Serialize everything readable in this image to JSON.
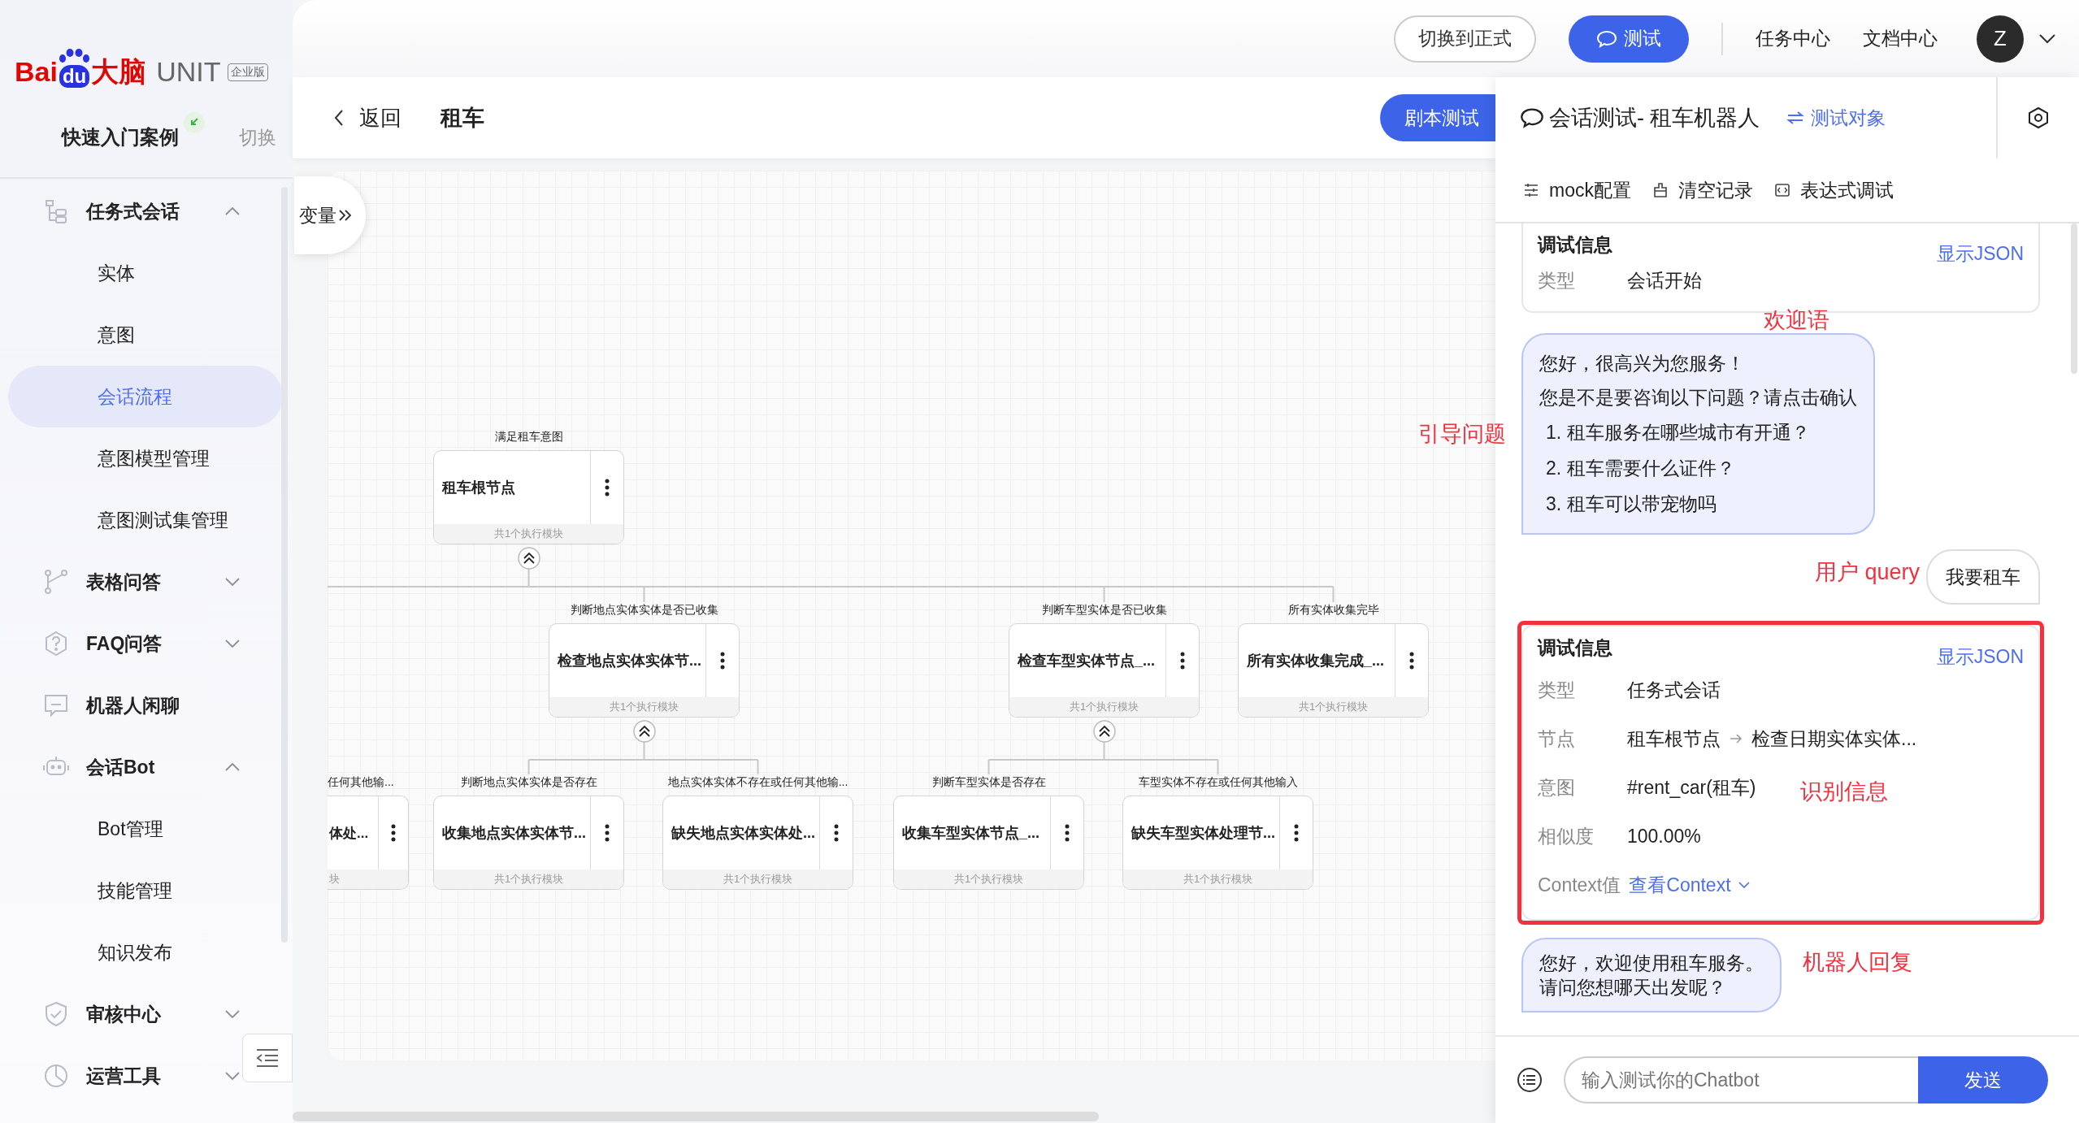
{
  "logo": {
    "parts": [
      "Bai",
      "du",
      "大脑"
    ],
    "product": "UNIT",
    "edition": "企业版"
  },
  "sidebar": {
    "quick_start": "快速入门案例",
    "switch": "切换",
    "items": [
      {
        "label": "任务式会话",
        "kind": "group",
        "expanded": true,
        "children": [
          {
            "label": "实体",
            "selected": false
          },
          {
            "label": "意图",
            "selected": false
          },
          {
            "label": "会话流程",
            "selected": true
          },
          {
            "label": "意图模型管理",
            "selected": false
          },
          {
            "label": "意图测试集管理",
            "selected": false
          }
        ]
      },
      {
        "label": "表格问答",
        "kind": "group",
        "expanded": false
      },
      {
        "label": "FAQ问答",
        "kind": "group",
        "expanded": false
      },
      {
        "label": "机器人闲聊",
        "kind": "page"
      },
      {
        "label": "会话Bot",
        "kind": "group",
        "expanded": true,
        "children": [
          {
            "label": "Bot管理",
            "selected": false
          },
          {
            "label": "技能管理",
            "selected": false
          },
          {
            "label": "知识发布",
            "selected": false
          }
        ]
      },
      {
        "label": "审核中心",
        "kind": "group",
        "expanded": false
      },
      {
        "label": "运营工具",
        "kind": "group",
        "expanded": false
      }
    ]
  },
  "top_bar": {
    "buttons": [
      {
        "label": "切换到正式",
        "kind": "outline"
      },
      {
        "label": "测试",
        "kind": "primary"
      }
    ],
    "links": [
      "任务中心",
      "文档中心"
    ],
    "avatar": "Z"
  },
  "header": {
    "back": "返回",
    "title": "租车",
    "script_test": "剧本测试"
  },
  "variables_tab": "变量",
  "flow": {
    "root": {
      "condition": "满足租车意图",
      "title": "租车根节点",
      "footer": "共1个执行模块",
      "expanded": true,
      "children": [
        {
          "condition": "判断地点实体实体是否已收集",
          "title": "检查地点实体实体节...",
          "footer": "共1个执行模块",
          "expanded": true,
          "children": [
            {
              "condition": "判断地点实体实体是否存在",
              "title": "收集地点实体实体节...",
              "footer": "共1个执行模块"
            },
            {
              "condition": "地点实体实体不存在或任何其他输...",
              "title": "缺失地点实体实体处...",
              "footer": "共1个执行模块"
            }
          ]
        },
        {
          "condition": "判断车型实体是否已收集",
          "title": "检查车型实体节点_...",
          "footer": "共1个执行模块",
          "expanded": true,
          "children": [
            {
              "condition": "判断车型实体是否存在",
              "title": "收集车型实体节点_...",
              "footer": "共1个执行模块"
            },
            {
              "condition": "车型实体不存在或任何其他输入",
              "title": "缺失车型实体处理节...",
              "footer": "共1个执行模块"
            }
          ]
        },
        {
          "condition": "所有实体收集完毕",
          "title": "所有实体收集完成_...",
          "footer": "共1个执行模块"
        }
      ]
    },
    "edge_nodes": [
      {
        "condition": "任何其他输...",
        "title": "体处...",
        "footer": "块"
      }
    ]
  },
  "test_panel": {
    "title": "会话测试- 租车机器人",
    "target": "测试对象",
    "tools": [
      "mock配置",
      "清空记录",
      "表达式调试"
    ],
    "messages": [
      {
        "kind": "debug",
        "highlighted": false,
        "title": "调试信息",
        "action": "显示JSON",
        "rows": [
          {
            "kind": "text",
            "label": "类型",
            "value": "会话开始"
          }
        ]
      },
      {
        "kind": "bot",
        "lines": [
          "您好，很高兴为您服务！",
          "您是不是要咨询以下问题？请点击确认"
        ],
        "options": [
          "1. 租车服务在哪些城市有开通？",
          "2. 租车需要什么证件？",
          "3. 租车可以带宠物吗"
        ]
      },
      {
        "kind": "user",
        "text": "我要租车"
      },
      {
        "kind": "debug",
        "highlighted": true,
        "title": "调试信息",
        "action": "显示JSON",
        "rows": [
          {
            "kind": "text",
            "label": "类型",
            "value": "任务式会话"
          },
          {
            "kind": "path",
            "label": "节点",
            "steps": [
              "租车根节点",
              "检查日期实体实体..."
            ]
          },
          {
            "kind": "text",
            "label": "意图",
            "value": "#rent_car(租车)"
          },
          {
            "kind": "text",
            "label": "相似度",
            "value": "100.00%"
          },
          {
            "kind": "link",
            "label": "Context值",
            "value": "查看Context"
          }
        ]
      },
      {
        "kind": "bot",
        "lines": [
          "您好，欢迎使用租车服务。",
          "请问您想哪天出发呢？"
        ]
      }
    ],
    "input": {
      "placeholder": "输入测试你的Chatbot"
    },
    "send": "发送"
  },
  "annotations": [
    "引导问题",
    "欢迎语",
    "用户 query",
    "识别信息",
    "机器人回复"
  ]
}
